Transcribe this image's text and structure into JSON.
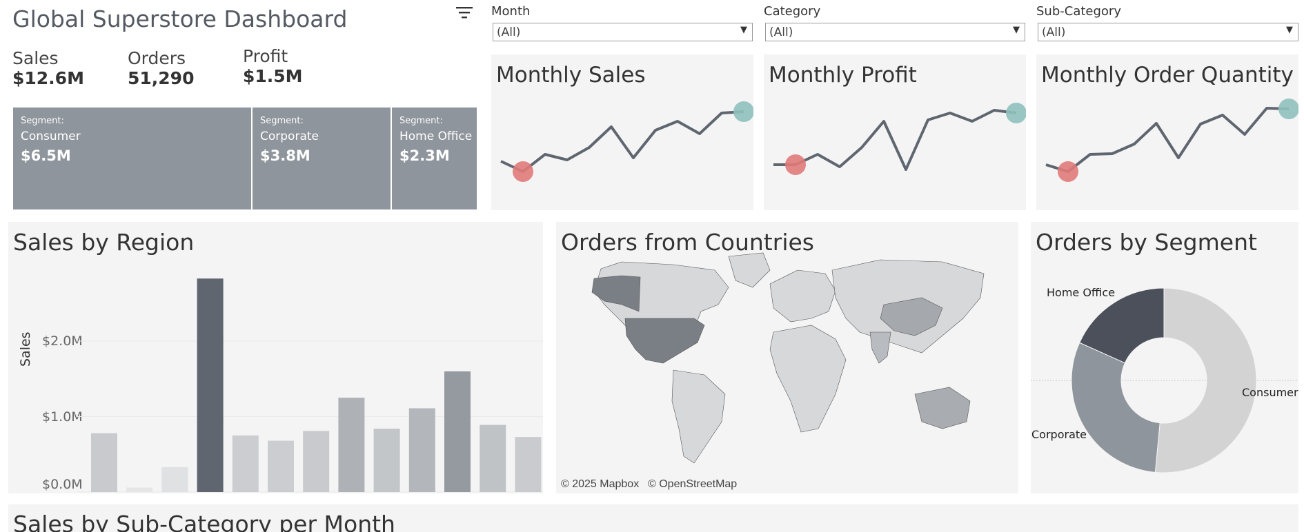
{
  "dashboard": {
    "title": "Global Superstore Dashboard"
  },
  "kpis": [
    {
      "label": "Sales",
      "value": "$12.6M"
    },
    {
      "label": "Orders",
      "value": "51,290"
    },
    {
      "label": "Profit",
      "value": "$1.5M"
    }
  ],
  "segments": [
    {
      "label": "Segment:",
      "name": "Consumer",
      "value": "$6.5M"
    },
    {
      "label": "Segment:",
      "name": "Corporate",
      "value": "$3.8M"
    },
    {
      "label": "Segment:",
      "name": "Home Office",
      "value": "$2.3M"
    }
  ],
  "filters": [
    {
      "label": "Month",
      "value": "(All)"
    },
    {
      "label": "Category",
      "value": "(All)"
    },
    {
      "label": "Sub-Category",
      "value": "(All)"
    }
  ],
  "icons": {
    "filter": "filter-icon",
    "dropdown_arrow": "chevron-down-icon"
  },
  "colors": {
    "line": "#5f6670",
    "min_marker": "#e07a7a",
    "max_marker": "#8fc1bd",
    "highlight_bar": "#5f6670",
    "panel_bg": "#f4f4f4",
    "segment_box": "#8f959c"
  },
  "sparklines": {
    "sales": {
      "title": "Monthly Sales"
    },
    "profit": {
      "title": "Monthly Profit"
    },
    "quantity": {
      "title": "Monthly Order Quantity"
    }
  },
  "region": {
    "title": "Sales by Region"
  },
  "map": {
    "title": "Orders from Countries",
    "attribution": [
      "© 2025 Mapbox",
      "© OpenStreetMap"
    ]
  },
  "donut": {
    "title": "Orders by Segment"
  },
  "subcat": {
    "title": "Sales by Sub-Category per Month"
  },
  "chart_data": [
    {
      "type": "line",
      "title": "Monthly Sales",
      "x": [
        1,
        2,
        3,
        4,
        5,
        6,
        7,
        8,
        9,
        10,
        11,
        12
      ],
      "values": [
        0.3,
        0.15,
        0.4,
        0.32,
        0.5,
        0.8,
        0.35,
        0.75,
        0.88,
        0.7,
        1.0,
        1.02
      ],
      "min_index": 1,
      "max_index": 11
    },
    {
      "type": "line",
      "title": "Monthly Profit",
      "x": [
        1,
        2,
        3,
        4,
        5,
        6,
        7,
        8,
        9,
        10,
        11,
        12
      ],
      "values": [
        0.25,
        0.25,
        0.4,
        0.22,
        0.5,
        0.88,
        0.18,
        0.9,
        1.0,
        0.88,
        1.04,
        1.0
      ],
      "min_index": 1,
      "max_index": 11
    },
    {
      "type": "line",
      "title": "Monthly Order Quantity",
      "x": [
        1,
        2,
        3,
        4,
        5,
        6,
        7,
        8,
        9,
        10,
        11,
        12
      ],
      "values": [
        0.25,
        0.15,
        0.4,
        0.41,
        0.55,
        0.85,
        0.35,
        0.84,
        0.97,
        0.69,
        1.07,
        1.06
      ],
      "min_index": 1,
      "max_index": 11
    },
    {
      "type": "bar",
      "title": "Sales by Region",
      "ylabel": "Sales",
      "yticks": [
        "$0.0M",
        "$1.0M",
        "$2.0M"
      ],
      "ylim": [
        0,
        2.85
      ],
      "values": [
        0.78,
        0.06,
        0.33,
        2.83,
        0.75,
        0.68,
        0.81,
        1.25,
        0.84,
        1.11,
        1.6,
        0.89,
        0.73
      ],
      "shades": [
        "#c8cacd",
        "#e6e6e6",
        "#e0e1e2",
        "#5f6670",
        "#cbcdd0",
        "#cbcdd0",
        "#c8cacd",
        "#aeb2b7",
        "#c3c6c9",
        "#b3b6ba",
        "#959aa1",
        "#c0c3c6",
        "#c9cbce"
      ]
    },
    {
      "type": "pie",
      "title": "Orders by Segment",
      "categories": [
        "Consumer",
        "Corporate",
        "Home Office"
      ],
      "values": [
        51.5,
        30.2,
        18.3
      ],
      "colors": [
        "#d3d3d3",
        "#8f959c",
        "#4b505a"
      ]
    }
  ]
}
